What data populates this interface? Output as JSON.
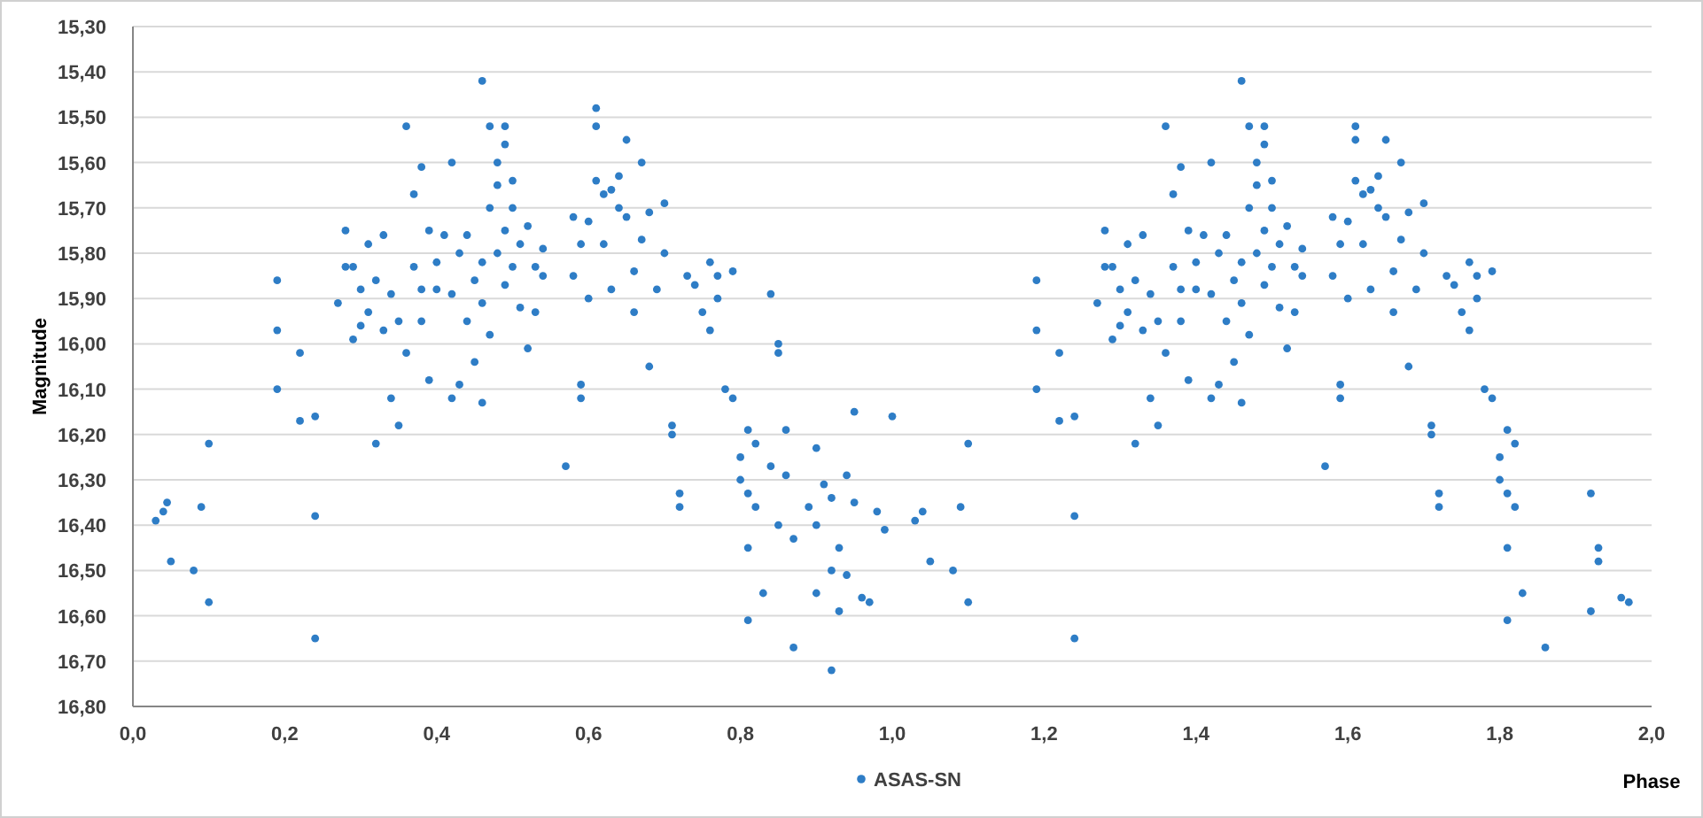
{
  "chart": {
    "chart_data": {
      "type": "scatter",
      "xlabel": "Phase",
      "ylabel": "Magnitude",
      "grid": "y",
      "xlim": [
        0,
        2
      ],
      "ylim": [
        16.8,
        15.3
      ],
      "xticks": [
        {
          "value": 0,
          "label": "0,0"
        },
        {
          "value": 0.2,
          "label": "0,2"
        },
        {
          "value": 0.4,
          "label": "0,4"
        },
        {
          "value": 0.6,
          "label": "0,6"
        },
        {
          "value": 0.8,
          "label": "0,8"
        },
        {
          "value": 1,
          "label": "1,0"
        },
        {
          "value": 1.2,
          "label": "1,2"
        },
        {
          "value": 1.4,
          "label": "1,4"
        },
        {
          "value": 1.6,
          "label": "1,6"
        },
        {
          "value": 1.8,
          "label": "1,8"
        },
        {
          "value": 2,
          "label": "2,0"
        }
      ],
      "yticks": [
        {
          "value": 15.3,
          "label": "15,30"
        },
        {
          "value": 15.4,
          "label": "15,40"
        },
        {
          "value": 15.5,
          "label": "15,50"
        },
        {
          "value": 15.6,
          "label": "15,60"
        },
        {
          "value": 15.7,
          "label": "15,70"
        },
        {
          "value": 15.8,
          "label": "15,80"
        },
        {
          "value": 15.9,
          "label": "15,90"
        },
        {
          "value": 16.0,
          "label": "16,00"
        },
        {
          "value": 16.1,
          "label": "16,10"
        },
        {
          "value": 16.2,
          "label": "16,20"
        },
        {
          "value": 16.3,
          "label": "16,30"
        },
        {
          "value": 16.4,
          "label": "16,40"
        },
        {
          "value": 16.5,
          "label": "16,50"
        },
        {
          "value": 16.6,
          "label": "16,60"
        },
        {
          "value": 16.7,
          "label": "16,70"
        },
        {
          "value": 16.8,
          "label": "16,80"
        }
      ],
      "x": [
        0.03,
        0.04,
        0.045,
        0.05,
        0.08,
        0.09,
        0.1,
        0.1,
        0.19,
        0.19,
        0.19,
        0.22,
        0.22,
        0.24,
        0.24,
        0.24,
        0.27,
        0.28,
        0.28,
        0.29,
        0.29,
        0.3,
        0.3,
        0.31,
        0.31,
        0.32,
        0.32,
        0.33,
        0.33,
        0.34,
        0.34,
        0.35,
        0.35,
        0.36,
        0.36,
        0.37,
        0.37,
        0.38,
        0.38,
        0.38,
        0.39,
        0.39,
        0.4,
        0.4,
        0.41,
        0.42,
        0.42,
        0.42,
        0.43,
        0.43,
        0.44,
        0.44,
        0.45,
        0.45,
        0.46,
        0.46,
        0.46,
        0.46,
        0.47,
        0.47,
        0.47,
        0.48,
        0.48,
        0.48,
        0.49,
        0.49,
        0.49,
        0.49,
        0.5,
        0.5,
        0.5,
        0.51,
        0.51,
        0.52,
        0.52,
        0.53,
        0.53,
        0.54,
        0.54,
        0.57,
        0.58,
        0.58,
        0.59,
        0.59,
        0.59,
        0.6,
        0.6,
        0.61,
        0.61,
        0.61,
        0.62,
        0.62,
        0.63,
        0.63,
        0.64,
        0.64,
        0.65,
        0.65,
        0.66,
        0.66,
        0.67,
        0.67,
        0.68,
        0.68,
        0.69,
        0.7,
        0.7,
        0.71,
        0.71,
        0.72,
        0.72,
        0.73,
        0.74,
        0.75,
        0.76,
        0.76,
        0.77,
        0.77,
        0.78,
        0.79,
        0.79,
        0.8,
        0.8,
        0.81,
        0.81,
        0.81,
        0.81,
        0.82,
        0.82,
        0.83,
        0.84,
        0.84,
        0.85,
        0.85,
        0.85,
        0.86,
        0.86,
        0.87,
        0.87,
        0.89,
        0.9,
        0.9,
        0.9,
        0.91,
        0.92,
        0.92,
        0.92,
        0.93,
        0.93,
        0.94,
        0.94,
        0.95,
        0.95,
        0.96,
        0.97,
        0.98,
        0.99,
        1.0,
        1.03,
        1.04,
        1.05,
        1.08,
        1.09,
        1.1,
        1.1,
        1.19,
        1.19,
        1.19,
        1.22,
        1.22,
        1.24,
        1.24,
        1.24,
        1.27,
        1.28,
        1.28,
        1.29,
        1.29,
        1.3,
        1.3,
        1.31,
        1.31,
        1.32,
        1.32,
        1.33,
        1.33,
        1.34,
        1.34,
        1.35,
        1.35,
        1.36,
        1.36,
        1.37,
        1.37,
        1.38,
        1.38,
        1.38,
        1.39,
        1.39,
        1.4,
        1.4,
        1.41,
        1.42,
        1.42,
        1.42,
        1.43,
        1.43,
        1.44,
        1.44,
        1.45,
        1.45,
        1.46,
        1.46,
        1.46,
        1.46,
        1.47,
        1.47,
        1.47,
        1.48,
        1.48,
        1.48,
        1.49,
        1.49,
        1.49,
        1.49,
        1.5,
        1.5,
        1.5,
        1.51,
        1.51,
        1.52,
        1.52,
        1.53,
        1.53,
        1.54,
        1.54,
        1.57,
        1.58,
        1.58,
        1.59,
        1.59,
        1.59,
        1.6,
        1.6,
        1.61,
        1.61,
        1.61,
        1.62,
        1.62,
        1.63,
        1.63,
        1.64,
        1.64,
        1.65,
        1.65,
        1.66,
        1.66,
        1.67,
        1.67,
        1.68,
        1.68,
        1.69,
        1.7,
        1.7,
        1.71,
        1.71,
        1.72,
        1.72,
        1.73,
        1.74,
        1.75,
        1.76,
        1.76,
        1.77,
        1.77,
        1.78,
        1.79,
        1.79,
        1.8,
        1.8,
        1.81,
        1.81,
        1.81,
        1.81,
        1.82,
        1.82,
        1.83,
        1.86,
        1.92,
        1.92,
        1.93,
        1.93,
        1.96,
        1.97
      ],
      "series": [
        {
          "name": "ASAS-SN",
          "color": "#2e7dc6",
          "values": [
            16.39,
            16.37,
            16.35,
            16.48,
            16.5,
            16.36,
            16.57,
            16.22,
            15.86,
            15.97,
            16.1,
            16.02,
            16.17,
            16.16,
            16.38,
            16.65,
            15.91,
            15.83,
            15.75,
            15.99,
            15.83,
            15.96,
            15.88,
            15.78,
            15.93,
            16.22,
            15.86,
            15.97,
            15.76,
            16.12,
            15.89,
            16.18,
            15.95,
            16.02,
            15.52,
            15.67,
            15.83,
            15.61,
            15.88,
            15.95,
            15.75,
            16.08,
            15.82,
            15.88,
            15.76,
            16.12,
            15.6,
            15.89,
            15.8,
            16.09,
            15.95,
            15.76,
            15.86,
            16.04,
            15.82,
            15.91,
            16.13,
            15.42,
            15.7,
            15.52,
            15.98,
            15.6,
            15.65,
            15.8,
            15.52,
            15.56,
            15.75,
            15.87,
            15.7,
            15.64,
            15.83,
            15.78,
            15.92,
            15.74,
            16.01,
            15.83,
            15.93,
            15.79,
            15.85,
            16.27,
            15.72,
            15.85,
            15.78,
            16.12,
            16.09,
            15.9,
            15.73,
            15.48,
            15.52,
            15.64,
            15.67,
            15.78,
            15.66,
            15.88,
            15.7,
            15.63,
            15.55,
            15.72,
            15.84,
            15.93,
            15.6,
            15.77,
            16.05,
            15.71,
            15.88,
            15.8,
            15.69,
            16.18,
            16.2,
            16.33,
            16.36,
            15.85,
            15.87,
            15.93,
            15.82,
            15.97,
            15.85,
            15.9,
            16.1,
            16.12,
            15.84,
            16.25,
            16.3,
            16.19,
            16.33,
            16.45,
            16.61,
            16.36,
            16.22,
            16.55,
            15.89,
            16.27,
            16.02,
            16.0,
            16.4,
            16.19,
            16.29,
            16.43,
            16.67,
            16.36,
            16.4,
            16.55,
            16.23,
            16.31,
            16.72,
            16.34,
            16.5,
            16.59,
            16.45,
            16.29,
            16.51,
            16.15,
            16.35,
            16.56,
            16.57,
            16.37,
            16.41,
            16.16,
            16.39,
            16.37,
            16.48,
            16.5,
            16.36,
            16.57,
            16.22,
            15.86,
            15.97,
            16.1,
            16.02,
            16.17,
            16.16,
            16.38,
            16.65,
            15.91,
            15.83,
            15.75,
            15.99,
            15.83,
            15.96,
            15.88,
            15.78,
            15.93,
            16.22,
            15.86,
            15.97,
            15.76,
            16.12,
            15.89,
            16.18,
            15.95,
            16.02,
            15.52,
            15.67,
            15.83,
            15.61,
            15.88,
            15.95,
            15.75,
            16.08,
            15.82,
            15.88,
            15.76,
            16.12,
            15.6,
            15.89,
            15.8,
            16.09,
            15.95,
            15.76,
            15.86,
            16.04,
            15.82,
            15.91,
            16.13,
            15.42,
            15.7,
            15.52,
            15.98,
            15.6,
            15.65,
            15.8,
            15.52,
            15.56,
            15.75,
            15.87,
            15.7,
            15.64,
            15.83,
            15.78,
            15.92,
            15.74,
            16.01,
            15.83,
            15.93,
            15.79,
            15.85,
            16.27,
            15.72,
            15.85,
            15.78,
            16.12,
            16.09,
            15.9,
            15.73,
            15.52,
            15.55,
            15.64,
            15.67,
            15.78,
            15.66,
            15.88,
            15.7,
            15.63,
            15.55,
            15.72,
            15.84,
            15.93,
            15.6,
            15.77,
            16.05,
            15.71,
            15.88,
            15.8,
            15.69,
            16.18,
            16.2,
            16.33,
            16.36,
            15.85,
            15.87,
            15.93,
            15.82,
            15.97,
            15.85,
            15.9,
            16.1,
            16.12,
            15.84,
            16.25,
            16.3,
            16.19,
            16.33,
            16.45,
            16.61,
            16.36,
            16.22,
            16.55,
            16.67,
            16.33,
            16.59,
            16.48,
            16.45,
            16.56,
            16.57
          ]
        }
      ]
    }
  }
}
